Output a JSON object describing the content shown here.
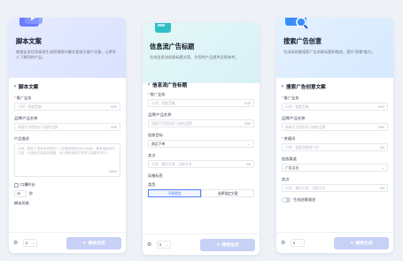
{
  "panels": [
    {
      "title": "脚本文案",
      "desc": "根据业务信息高效生成短视频口播文案吸引客户注意，让更多人了解您的产品。",
      "sub_title": "脚本文案",
      "fields": {
        "product_name_label": "推广业务",
        "product_name_placeholder": "示例：智能音箱",
        "product_name_count": "0/30",
        "brand_label": "品牌/产品名称",
        "brand_placeholder": "请填写可提现学习者的品牌",
        "brand_count": "0/50",
        "desc_label": "产品描述",
        "desc_placeholder": "示例：智能了现身热效率的入工智能音箱支持aux功能，拥有海量音乐内容，AI语音交互高效便捷，可以帮助家庭中的学习者更好学习。",
        "desc_count": "0/500",
        "checkbox_label": "口播时长",
        "duration_value": "30",
        "duration_unit": "秒",
        "hint_label": "脚本风格"
      },
      "footer": {
        "count": "5",
        "button": "继续生成"
      }
    },
    {
      "title": "信息流广告标题",
      "desc": "生成信息流创意标题文案，为您的产品提供灵感参考。",
      "sub_title": "信息流广告标题",
      "fields": {
        "product_name_label": "推广业务",
        "product_name_placeholder": "示例：智能音箱",
        "product_name_count": "0/30",
        "brand_label": "品牌/产品名称",
        "brand_placeholder": "请填写可提现学习者的品牌",
        "brand_count": "0/50",
        "platform_label": "投放目标",
        "platform_value": "商品下单",
        "selling_label": "卖点",
        "selling_placeholder": "示例：操作方便、功能齐全",
        "selling_count": "0/5",
        "style_label": "风格标签",
        "type_label": "类型",
        "tab_a": "不限类型",
        "tab_b": "选择指定文案"
      },
      "footer": {
        "count": "5",
        "button": "继续生成"
      }
    },
    {
      "title": "搜索广告创意",
      "desc": "生成高质量搜索广告创意标题和描述，提升“获量”能力。",
      "sub_title": "搜索广告创意文案",
      "fields": {
        "product_name_label": "推广业务",
        "product_name_placeholder": "示例：智能音箱",
        "product_name_count": "0/30",
        "brand_label": "品牌/产品名称",
        "brand_placeholder": "请填写可提现学习者的品牌",
        "brand_count": "0/50",
        "keyword_label": "关键词",
        "keyword_placeholder": "示例：智能音箱哪个好",
        "keyword_count": "0/5",
        "platform_label": "投放渠道",
        "platform_value": "广告点击",
        "selling_label": "卖点",
        "selling_placeholder": "示例：操作方便、功能齐全",
        "selling_count": "0/5",
        "toggle_label": "生成创意描述"
      },
      "footer": {
        "count": "5",
        "button": "继续生成"
      }
    }
  ],
  "icons": {
    "back": "chevron-left-icon",
    "settings": "gear-icon",
    "dropdown": "chevron-down-icon",
    "spark": "sparkle-icon"
  },
  "colors": {
    "accent": "#4f7cff",
    "button_disabled": "#c7d0f5"
  }
}
